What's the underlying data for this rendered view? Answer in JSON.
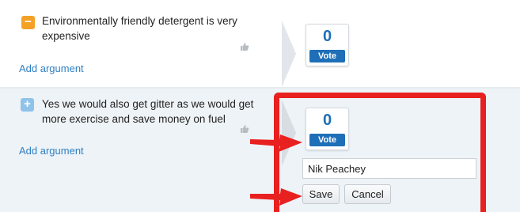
{
  "arguments": [
    {
      "type": "con",
      "icon": "minus-icon",
      "icon_glyph": "−",
      "icon_color": "#f4a126",
      "text": "Environmentally friendly detergent is very expensive",
      "add_label": "Add argument",
      "vote": {
        "count": "0",
        "label": "Vote"
      }
    },
    {
      "type": "pro",
      "icon": "plus-icon",
      "icon_glyph": "+",
      "icon_color": "#8fc3ea",
      "text": "Yes we would also get gitter as we would get more exercise and save money on fuel",
      "add_label": "Add argument",
      "vote": {
        "count": "0",
        "label": "Vote"
      }
    }
  ],
  "vote_form": {
    "name_value": "Nik Peachey",
    "save_label": "Save",
    "cancel_label": "Cancel"
  },
  "colors": {
    "accent": "#1e6fb8",
    "link": "#2e7fc2",
    "annotation": "#e8201f"
  }
}
